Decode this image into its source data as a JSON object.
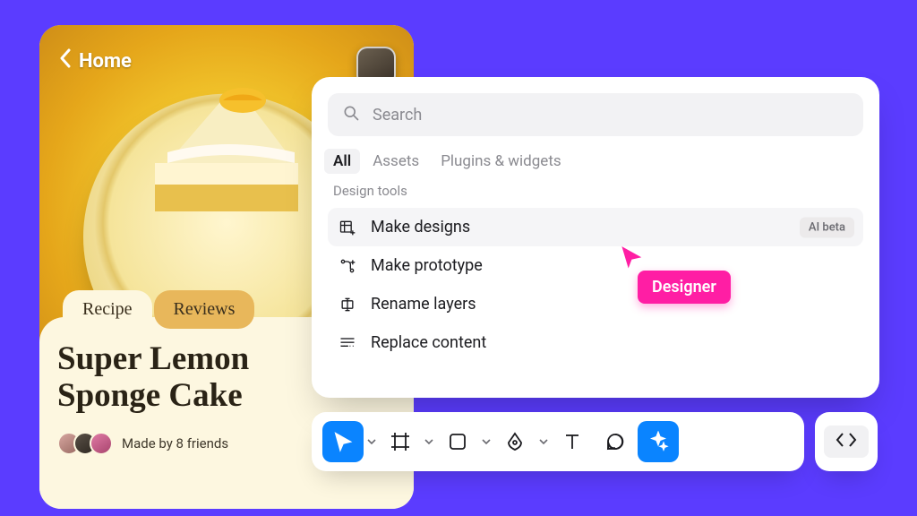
{
  "mobile": {
    "back_label": "Home",
    "tabs": {
      "active": "Recipe",
      "inactive": "Reviews"
    },
    "title_line1": "Super Lemon",
    "title_line2": "Sponge Cake",
    "made_by": "Made by 8 friends"
  },
  "panel": {
    "search_placeholder": "Search",
    "filter_tabs": {
      "all": "All",
      "assets": "Assets",
      "plugins": "Plugins & widgets"
    },
    "section_label": "Design tools",
    "actions": {
      "make_designs": {
        "label": "Make designs",
        "badge": "AI beta"
      },
      "make_prototype": {
        "label": "Make prototype"
      },
      "rename_layers": {
        "label": "Rename layers"
      },
      "replace_content": {
        "label": "Replace content"
      }
    }
  },
  "cursor_label": "Designer",
  "toolbar": {
    "tools": [
      "move",
      "frame",
      "rect",
      "pen",
      "text",
      "comment",
      "ai"
    ]
  }
}
